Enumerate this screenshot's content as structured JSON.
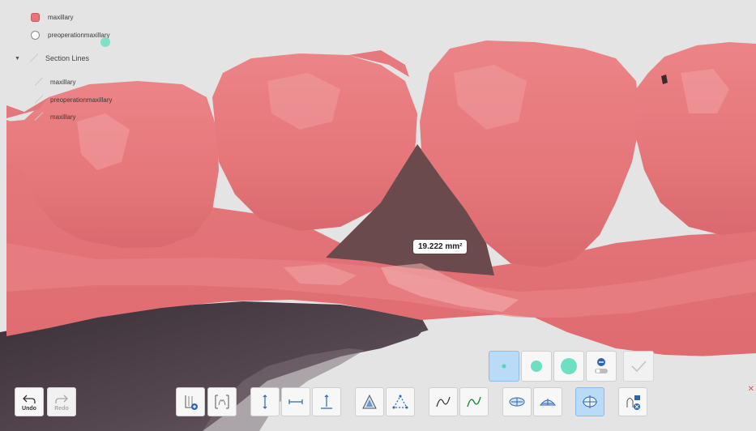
{
  "scene_tree": {
    "items": [
      {
        "label": "maxillary",
        "swatch_color": "#e6757a",
        "icon": "hexagon-swatch-icon"
      },
      {
        "label": "preoperationmaxillary",
        "swatch_color": "#ffffff",
        "icon": "circle-swatch-icon"
      }
    ],
    "section_lines": {
      "label": "Section Lines",
      "expanded": true,
      "children": [
        {
          "label": "maxillary"
        },
        {
          "label": "preoperationmaxillary"
        },
        {
          "label": "maxillary"
        }
      ]
    }
  },
  "measurement": {
    "area_label": "19.222 mm²"
  },
  "toolbar": {
    "undo_label": "Undo",
    "redo_label": "Redo",
    "brush_sizes": [
      "small-dot-icon",
      "medium-dot-icon",
      "large-dot-icon"
    ],
    "selected_brush": "small",
    "tools": [
      "add-section-icon",
      "section-frame-icon",
      "vertical-line-icon",
      "horizontal-line-icon",
      "height-measure-icon",
      "triangle-area-icon",
      "triangle-dash-icon",
      "curve-line-icon",
      "curve-line-alt-icon",
      "oval-dots-icon",
      "arch-dots-icon",
      "cross-oval-icon",
      "remove-section-icon"
    ]
  },
  "colors": {
    "tooth": "#e6757a",
    "tooth_highlight": "#f3a8aa",
    "gap": "#6b4a4d",
    "underside": "#4a3d44",
    "active_button": "#b9dbf8",
    "accent_teal": "#6ee0c2"
  }
}
